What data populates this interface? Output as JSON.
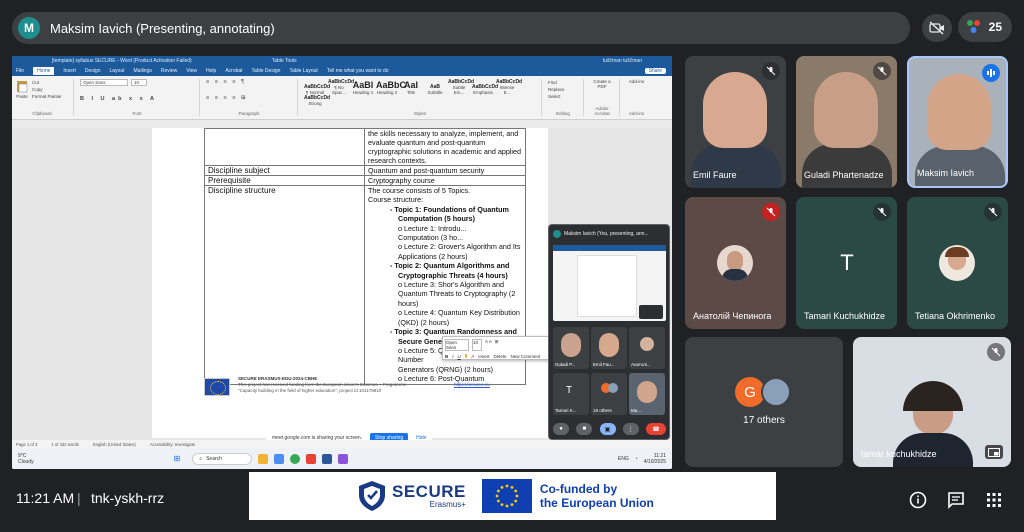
{
  "presenter": {
    "initial": "M",
    "label": "Maksim Iavich (Presenting, annotating)"
  },
  "people_count": "25",
  "word": {
    "title": "[template] syllabus SECURE - Word (Product Activation Failed)",
    "context_tab": "Table Tools",
    "user": "tuščman tuščman",
    "tabs": [
      "File",
      "Home",
      "Insert",
      "Design",
      "Layout",
      "Mailings",
      "Review",
      "View",
      "Help",
      "Acrobat",
      "Table Design",
      "Table Layout"
    ],
    "tell_me": "Tell me what you want to do",
    "share": "Share",
    "font_name": "Open Sans",
    "font_size": "10",
    "clipboard": {
      "paste": "Paste",
      "cut": "Cut",
      "copy": "Copy",
      "format_painter": "Format Painter"
    },
    "groups": {
      "clipboard": "Clipboard",
      "font": "Font",
      "paragraph": "Paragraph",
      "styles": "Styles",
      "editing": "Editing",
      "adobe": "Adobe Acrobat",
      "addins": "Add-ins"
    },
    "styles": [
      {
        "sample": "AaBbCcDd",
        "name": "¶ Normal"
      },
      {
        "sample": "AaBbCcDd",
        "name": "¶ No Spac..."
      },
      {
        "sample": "AaBl",
        "name": "Heading 1"
      },
      {
        "sample": "AaBbC",
        "name": "Heading 2"
      },
      {
        "sample": "AaI",
        "name": "Title"
      },
      {
        "sample": "AaB",
        "name": "Subtitle"
      },
      {
        "sample": "AaBbCcDd",
        "name": "Subtle Em..."
      },
      {
        "sample": "AaBbCcDd",
        "name": "Emphasis"
      },
      {
        "sample": "AaBbCcDd",
        "name": "Intense E..."
      },
      {
        "sample": "AaBbCcDd",
        "name": "Strong"
      }
    ],
    "editing": {
      "find": "Find",
      "replace": "Replace",
      "select": "Select"
    },
    "create_pdf": "Create a PDF",
    "addins": "Add-ins",
    "status": {
      "page": "Page 1 of 3",
      "words": "1 of 432 words",
      "lang": "English (United States)",
      "accessibility": "Accessibility: Investigate"
    }
  },
  "document": {
    "intro_lines": [
      "the skills necessary to analyze, implement, and",
      "evaluate quantum and post-quantum",
      "cryptographic solutions in academic and applied",
      "research contexts."
    ],
    "rows": [
      {
        "label": "Discipline subject",
        "value": "Quantum and post-quantum security"
      },
      {
        "label": "Prerequisite",
        "value": "Cryptography course"
      },
      {
        "label": "Discipline structure"
      }
    ],
    "structure_lines": [
      {
        "cls": "lect",
        "text": "The course consists of 5 Topics."
      },
      {
        "cls": "lect",
        "text": "Course structure:"
      },
      {
        "cls": "topic",
        "text": "-     Topic 1: Foundations of Quantum"
      },
      {
        "cls": "topic2",
        "text": "Computation (5 hours)"
      },
      {
        "cls": "topic2n",
        "text": "o Lecture 1: Introdu..."
      },
      {
        "cls": "topic2n",
        "text": "Computation (3 ho..."
      },
      {
        "cls": "topic2n",
        "text": "o Lecture 2: Grover's Algorithm and Its"
      },
      {
        "cls": "topic2n",
        "text": "Applications (2 hours)"
      },
      {
        "cls": "topic",
        "text": "-     Topic 2: Quantum Algorithms and"
      },
      {
        "cls": "topic2",
        "text": "Cryptographic Threats (4 hours)"
      },
      {
        "cls": "topic2n",
        "text": "o Lecture 3: Shor's Algorithm and"
      },
      {
        "cls": "topic2n",
        "text": "Quantum Threats to Cryptography (2"
      },
      {
        "cls": "topic2n",
        "text": "hours)"
      },
      {
        "cls": "topic2n",
        "text": "o Lecture 4: Quantum Key Distribution"
      },
      {
        "cls": "topic2n",
        "text": "(QKD) (2 hours)"
      },
      {
        "cls": "topic",
        "text": "-     Topic 3: Quantum Randomness and"
      },
      {
        "cls": "topic2",
        "text": "Secure Generators (4 hours)"
      },
      {
        "cls": "topic2n",
        "text": "o Lecture 5: Quantum Random Number"
      },
      {
        "cls": "topic2n",
        "text": "Generators (QRNG) (2 hours)"
      },
      {
        "cls": "topic2n",
        "text": "o Lecture 6: Post-Quantum"
      }
    ],
    "footer": {
      "line1": "SECURE ERASMUS-EDU-2024-CBHE",
      "line2": "This project has received funding from the European Union's Erasmus + Programme",
      "line3": "\"Capacity building in the field of higher education\", project Id 101179810",
      "link": "https://securee.eu"
    },
    "mini_toolbar": {
      "font": "Open Sans",
      "size": "10",
      "insert": "Insert",
      "delete": "Delete",
      "new_comment": "New Comment"
    }
  },
  "share_banner": {
    "text": "meet.google.com is sharing your screen.",
    "stop": "Stop sharing",
    "hide": "Hide"
  },
  "taskbar": {
    "weather": "9°C",
    "weather_desc": "Cloudy",
    "search": "Search",
    "lang": "ENG",
    "time": "11:21",
    "date": "4/10/2025"
  },
  "pip": {
    "header": "Maksim Iavich (You, presenting, ann...",
    "tiles": [
      {
        "name": "Guladi P..."
      },
      {
        "name": "Emil Fau..."
      },
      {
        "name": "Анатолі..."
      },
      {
        "name": "Tamari K...",
        "letter": "T"
      },
      {
        "name": "19 others"
      },
      {
        "name": "Ma..."
      }
    ]
  },
  "participants": [
    {
      "id": "emil",
      "name": "Emil Faure",
      "muted": true
    },
    {
      "id": "guladi",
      "name": "Guladi Phartenadze",
      "muted": true
    },
    {
      "id": "maksim",
      "name": "Maksim Iavich",
      "speaking": true
    },
    {
      "id": "anatolii",
      "name": "Анатолій Чепинога",
      "muted": true
    },
    {
      "id": "tamari",
      "name": "Tamari Kuchukhidze",
      "letter": "T",
      "muted": true
    },
    {
      "id": "tetiana",
      "name": "Tetiana Okhrimenko",
      "muted": true
    }
  ],
  "others": {
    "initial": "G",
    "label": "17 others"
  },
  "tamar": {
    "name": "tamar kuchukhidze",
    "muted": true
  },
  "bottom": {
    "clock": "11:21 AM",
    "separator": "|",
    "meeting_code": "tnk-yskh-rrz"
  },
  "banner": {
    "secure": "SECURE",
    "erasmus": "Erasmus+",
    "cofunded_line1": "Co-funded by",
    "cofunded_line2": "the European Union"
  },
  "colors": {
    "accent": "#1a73e8",
    "end_call": "#ea4335",
    "word_blue": "#1c5a9c",
    "tile_bg": "#3c4043"
  }
}
